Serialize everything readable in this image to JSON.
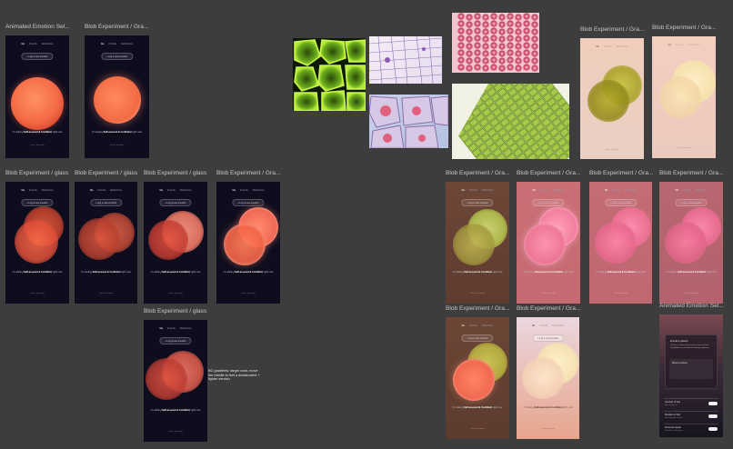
{
  "frames": {
    "f1": "Animated Emotion Sel...",
    "f2": "Blob Experiment / Gra...",
    "f3": "Blob Experiment / glass",
    "f4": "Blob Experiment / glass",
    "f5": "Blob Experiment / glass",
    "f6": "Blob Experiment / Gra...",
    "f7": "Blob Experiment / glass",
    "f8": "Blob Experiment / Gra...",
    "f9": "Blob Experiment / Gra...",
    "f10": "Blob Experiment / Gra...",
    "f11": "Blob Experiment / Gra...",
    "f12": "Blob Experiment / Gra...",
    "f13": "Blob Experiment / Gra...",
    "f14": "Blob Experiment / Gra...",
    "f15": "Blob Experiment / Gra...",
    "f16": "Animated Emotion Sel..."
  },
  "screen": {
    "nav1": "Me",
    "nav2": "Friends",
    "nav3": "Reflections",
    "pill": "+ Log a new emotion",
    "prompt_pre": "I'm feeling ",
    "prompt_bold": "Self-assured & Confident",
    "prompt_post": " right now",
    "footer": "Tap to log today",
    "footer_icon": "~"
  },
  "note": "BG gradients; target color, move the middle to feel a desaturated + lighter version",
  "emotion_selector": {
    "card_title": "Emotion palette",
    "card_body": "Choose a colour that matches how you feel. Drag blobs to mix different feelings together.",
    "inner_title": "Mixed emotions",
    "rows": [
      {
        "label": "Intensity of feel",
        "sub": "How strong is it"
      },
      {
        "label": "Duration of feel",
        "sub": "How long has it lasted"
      },
      {
        "label": "Personal impact",
        "sub": "How does it affect you"
      }
    ]
  },
  "colors": {
    "canvas": "#3d3d3d",
    "dark_screen": "#0d0d1e",
    "blob_orange": "#ff7a52",
    "blob_pink": "#ff8fb4",
    "blob_olive": "#c9c73a",
    "blob_cream": "#fff0c0"
  },
  "images": [
    "plant-cells-green-microscopy",
    "onion-cells-purple-microscopy",
    "red-blood-cells-microscopy",
    "pink-nuclei-cells-microscopy",
    "leaf-tissue-green-microscopy"
  ]
}
